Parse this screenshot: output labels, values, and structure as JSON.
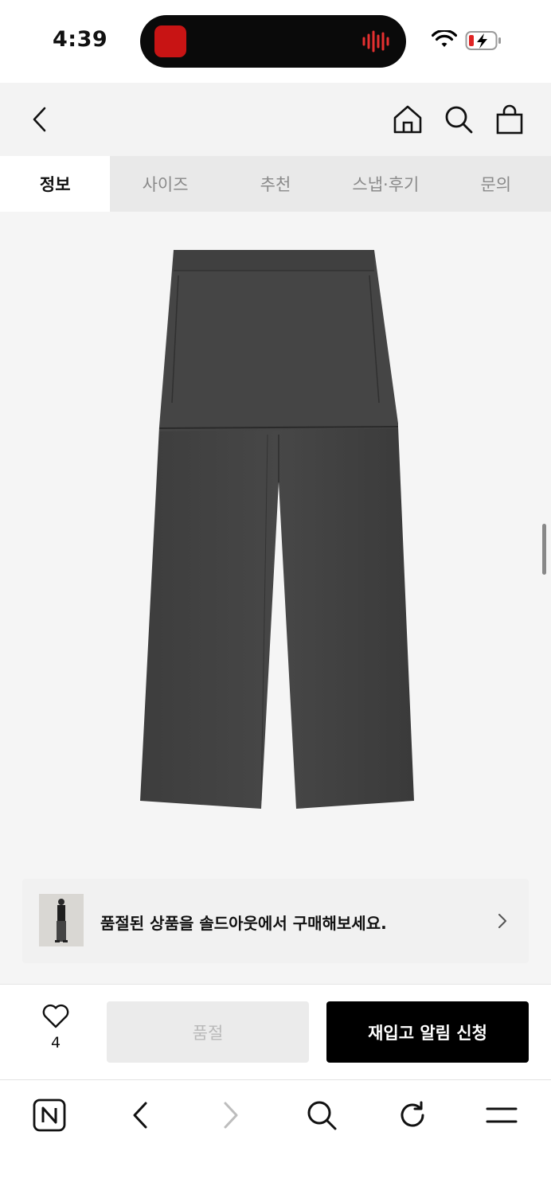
{
  "status_bar": {
    "time": "4:39"
  },
  "header": {
    "icons": [
      "back-icon",
      "home-icon",
      "search-icon",
      "shopping-bag-icon"
    ]
  },
  "tabs": [
    {
      "label": "정보",
      "active": true
    },
    {
      "label": "사이즈",
      "active": false
    },
    {
      "label": "추천",
      "active": false
    },
    {
      "label": "스냅·후기",
      "active": false
    },
    {
      "label": "문의",
      "active": false
    }
  ],
  "product": {
    "image": "grey-skirt-layered-pants",
    "soldout_banner": {
      "text": "품절된 상품을 솔드아웃에서 구매해보세요."
    }
  },
  "action_bar": {
    "like_count": "4",
    "soldout_label": "품절",
    "restock_label": "재입고 알림 신청"
  },
  "browser_bar": {
    "icons": [
      "naver-n-icon",
      "back-arrow-icon",
      "forward-arrow-icon",
      "search-icon",
      "refresh-icon",
      "menu-icon"
    ]
  },
  "colors": {
    "primary": "#000000",
    "disabled_bg": "#ebebeb",
    "disabled_text": "#b9b9b9",
    "tab_bg": "#e9e9e9",
    "header_bg": "#f3f3f3"
  }
}
